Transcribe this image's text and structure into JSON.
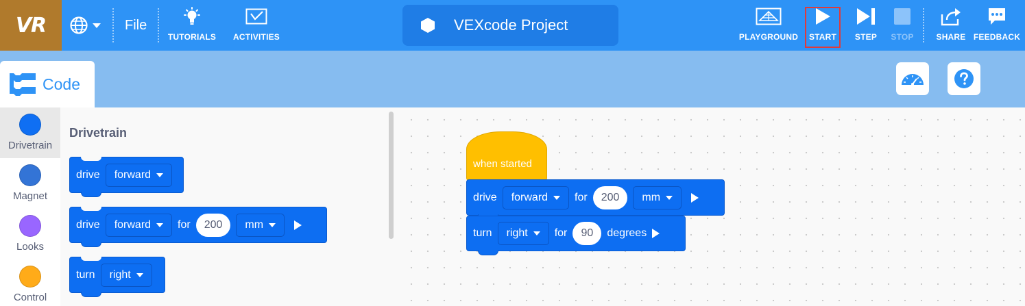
{
  "app": {
    "logo_text": "VR",
    "file_label": "File",
    "project_title": "VEXcode Project"
  },
  "toolbar": {
    "tutorials": "TUTORIALS",
    "activities": "ACTIVITIES",
    "playground": "PLAYGROUND",
    "start": "START",
    "step": "STEP",
    "stop": "STOP",
    "share": "SHARE",
    "feedback": "FEEDBACK"
  },
  "tabs": {
    "code": "Code"
  },
  "categories": [
    {
      "label": "Drivetrain",
      "color": "#0f6ff3"
    },
    {
      "label": "Magnet",
      "color": "#3374d6"
    },
    {
      "label": "Looks",
      "color": "#9966ff"
    },
    {
      "label": "Control",
      "color": "#ffab19"
    }
  ],
  "flyout": {
    "title": "Drivetrain",
    "block1": {
      "word": "drive",
      "direction": "forward"
    },
    "block2": {
      "word": "drive",
      "direction": "forward",
      "for": "for",
      "value": "200",
      "unit": "mm"
    },
    "block3": {
      "word": "turn",
      "direction": "right"
    }
  },
  "workspace": {
    "hat": "when started",
    "drive": {
      "word": "drive",
      "direction": "forward",
      "for": "for",
      "value": "200",
      "unit": "mm"
    },
    "turn": {
      "word": "turn",
      "direction": "right",
      "for": "for",
      "value": "90",
      "unit": "degrees"
    }
  },
  "colors": {
    "topbar": "#2e93f6",
    "subbar": "#86bcf0",
    "logo_bg": "#b07a2c",
    "motion_block": "#0d6ef2",
    "event_block": "#ffbf00",
    "highlight": "#e03a3a"
  }
}
